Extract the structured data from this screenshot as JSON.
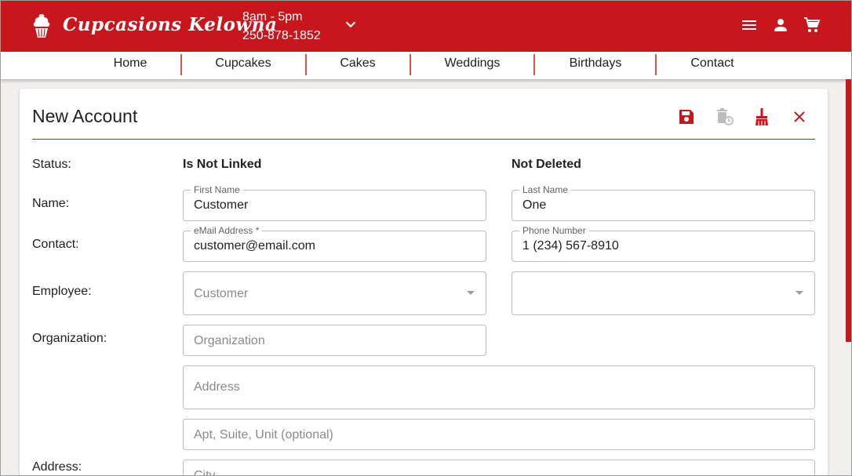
{
  "header": {
    "brand": "Cupcasions Kelowna",
    "hours": "8am - 5pm",
    "phone": "250-878-1852",
    "icons": [
      "cupcake-logo-icon",
      "chevron-down-icon",
      "menu-icon",
      "account-icon",
      "cart-icon"
    ]
  },
  "nav": {
    "items": [
      "Home",
      "Cupcakes",
      "Cakes",
      "Weddings",
      "Birthdays",
      "Contact"
    ]
  },
  "form": {
    "title": "New Account",
    "actions": [
      "save-icon",
      "delete-restore-icon",
      "clear-icon",
      "close-icon"
    ],
    "labels": {
      "status": "Status:",
      "name": "Name:",
      "contact": "Contact:",
      "employee": "Employee:",
      "organization": "Organization:",
      "address": "Address:"
    },
    "status": {
      "link": "Is Not Linked",
      "deleted": "Not Deleted"
    },
    "first_name": {
      "label": "First Name",
      "value": "Customer"
    },
    "last_name": {
      "label": "Last Name",
      "value": "One"
    },
    "email": {
      "label": "eMail Address *",
      "value": "customer@email.com"
    },
    "phone": {
      "label": "Phone Number",
      "value": "1 (234) 567-8910"
    },
    "employee_type": {
      "placeholder": "Customer"
    },
    "employee_other": {
      "placeholder": ""
    },
    "organization": {
      "placeholder": "Organization"
    },
    "address": {
      "placeholder": "Address"
    },
    "apt": {
      "placeholder": "Apt, Suite, Unit (optional)"
    },
    "city": {
      "placeholder": "City"
    }
  },
  "colors": {
    "brand_red": "#c8161d",
    "disabled_icon": "#bdbdbd"
  }
}
